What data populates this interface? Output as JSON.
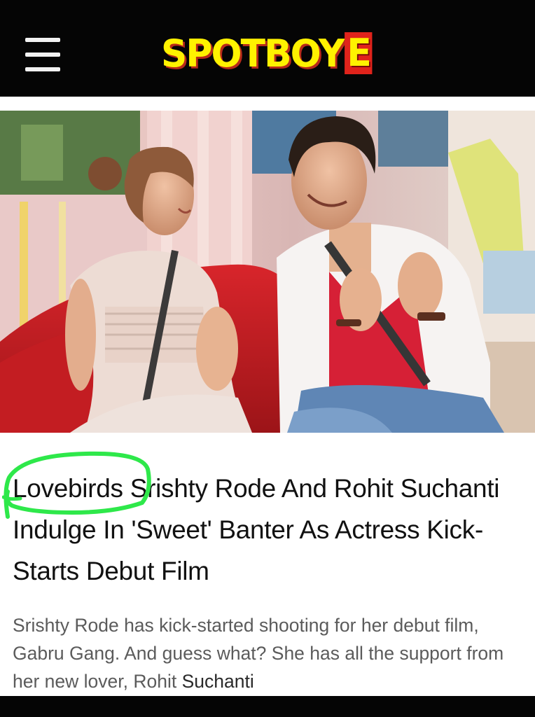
{
  "header": {
    "logo_text": "SPOTBOY",
    "logo_e": "E",
    "logo_colors": {
      "text": "#fff200",
      "shadow": "#b82a1a",
      "e_box": "#e0231b"
    },
    "menu_icon": "hamburger-menu-icon",
    "background": "#050505"
  },
  "article": {
    "hero_image_subject": "photo-of-two-people-seated-on-red-couch",
    "headline_first_word": "Lovebirds",
    "headline_rest": " Srishty Rode And Rohit Suchanti Indulge In 'Sweet' Banter As Actress Kick-Starts Debut Film",
    "summary_text": "Srishty Rode has kick-started shooting for her debut film, Gabru Gang. And guess what? She has all the support from her new lover, Rohit ",
    "summary_last_word": "Suchanti",
    "highlight_color": "#2ee84a"
  }
}
